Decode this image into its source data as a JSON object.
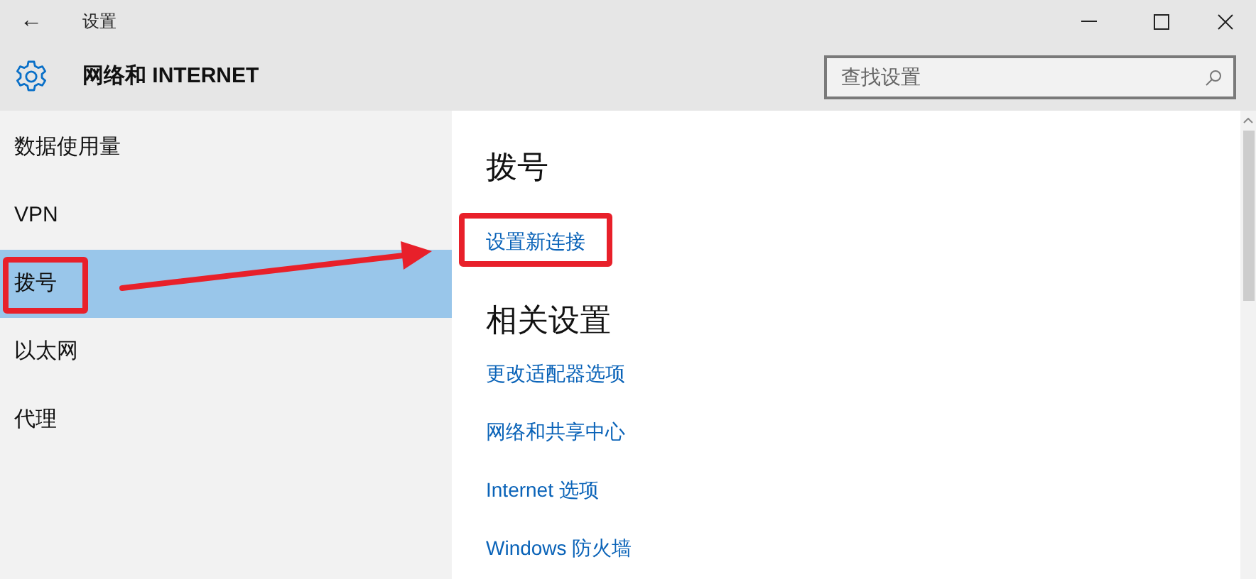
{
  "window": {
    "title": "设置",
    "back": "←"
  },
  "header": {
    "title": "网络和 INTERNET",
    "search": {
      "placeholder": "查找设置"
    }
  },
  "sidebar": {
    "items": [
      {
        "label": "数据使用量",
        "selected": false,
        "highlighted": false
      },
      {
        "label": "VPN",
        "selected": false,
        "highlighted": false
      },
      {
        "label": "拨号",
        "selected": true,
        "highlighted": true
      },
      {
        "label": "以太网",
        "selected": false,
        "highlighted": false
      },
      {
        "label": "代理",
        "selected": false,
        "highlighted": false
      }
    ]
  },
  "content": {
    "sections": [
      {
        "heading": "拨号",
        "links": [
          {
            "label": "设置新连接",
            "highlighted": true
          }
        ]
      },
      {
        "heading": "相关设置",
        "links": [
          {
            "label": "更改适配器选项",
            "highlighted": false
          },
          {
            "label": "网络和共享中心",
            "highlighted": false
          },
          {
            "label": "Internet 选项",
            "highlighted": false
          },
          {
            "label": "Windows 防火墙",
            "highlighted": false
          }
        ]
      }
    ]
  },
  "annotation": {
    "arrow": true
  }
}
